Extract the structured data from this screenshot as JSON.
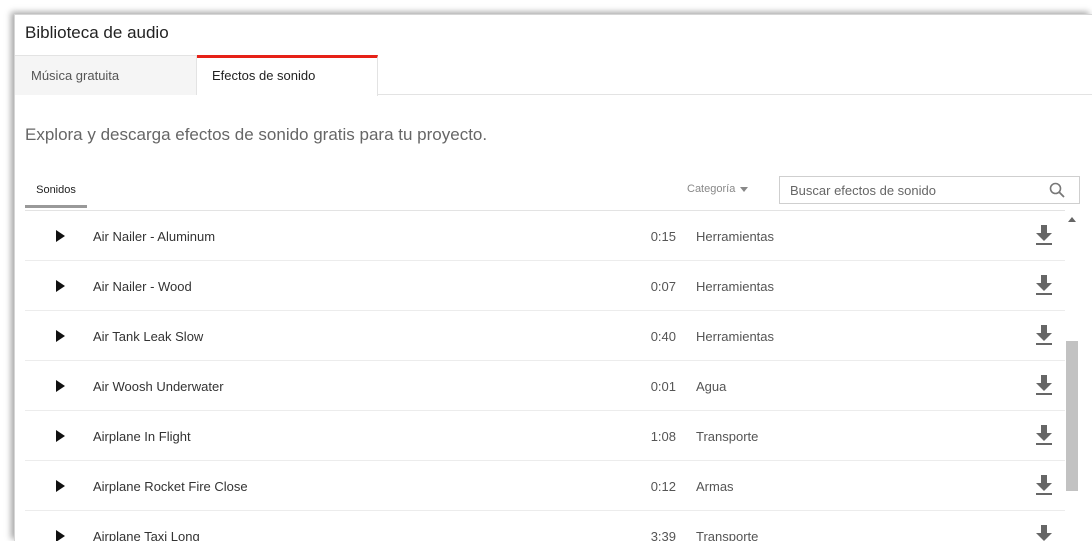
{
  "app": {
    "title": "Biblioteca de audio"
  },
  "tabs": [
    {
      "label": "Música gratuita"
    },
    {
      "label": "Efectos de sonido"
    }
  ],
  "intro": "Explora y descarga efectos de sonido gratis para tu proyecto.",
  "subtabs": {
    "sounds": "Sonidos"
  },
  "filter": {
    "category_label": "Categoría"
  },
  "search": {
    "placeholder": "Buscar efectos de sonido"
  },
  "sounds": [
    {
      "name": "Air Nailer - Aluminum",
      "duration": "0:15",
      "category": "Herramientas"
    },
    {
      "name": "Air Nailer - Wood",
      "duration": "0:07",
      "category": "Herramientas"
    },
    {
      "name": "Air Tank Leak Slow",
      "duration": "0:40",
      "category": "Herramientas"
    },
    {
      "name": "Air Woosh Underwater",
      "duration": "0:01",
      "category": "Agua"
    },
    {
      "name": "Airplane In Flight",
      "duration": "1:08",
      "category": "Transporte"
    },
    {
      "name": "Airplane Rocket Fire Close",
      "duration": "0:12",
      "category": "Armas"
    },
    {
      "name": "Airplane Taxi Long",
      "duration": "3:39",
      "category": "Transporte"
    }
  ],
  "icons": {
    "play": "play-icon",
    "download": "download-icon",
    "search": "search-icon"
  },
  "colors": {
    "active_tab_accent": "#e62117",
    "icon": "#666666",
    "text_muted": "#666666"
  }
}
